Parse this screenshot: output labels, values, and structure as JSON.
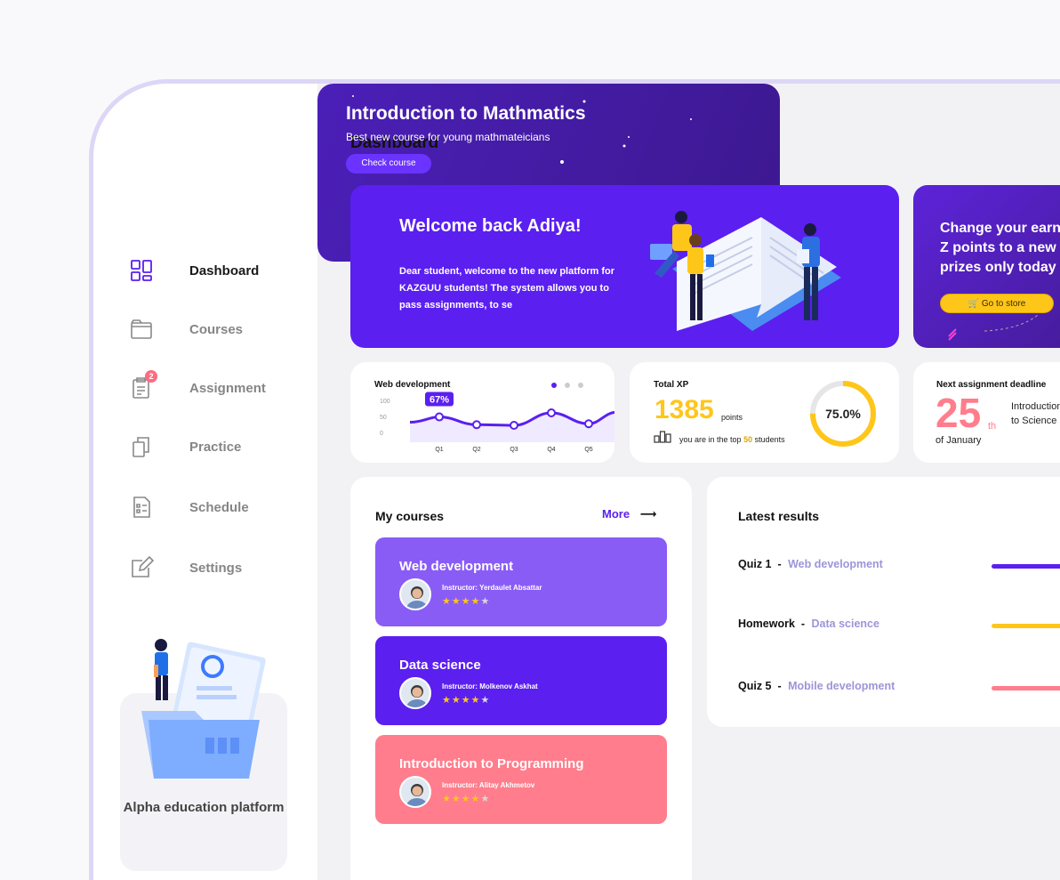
{
  "sidebar": {
    "items": [
      {
        "label": "Dashboard",
        "icon": "dashboard-icon",
        "active": true
      },
      {
        "label": "Courses",
        "icon": "folder-icon"
      },
      {
        "label": "Assignment",
        "icon": "clipboard-icon",
        "badge": "2"
      },
      {
        "label": "Practice",
        "icon": "copy-icon"
      },
      {
        "label": "Schedule",
        "icon": "schedule-icon"
      },
      {
        "label": "Settings",
        "icon": "edit-icon"
      }
    ],
    "promo_text": "Alpha education platform"
  },
  "main": {
    "title": "Dashboard",
    "welcome": {
      "heading": "Welcome back Adiya!",
      "body": "Dear student, welcome to the new platform for KAZGUU students! The system allows you to pass assignments, to se"
    },
    "store": {
      "text": "Change your earned Z points to a new prizes only today",
      "button": "Go to store"
    },
    "webdev_card": {
      "title": "Web development",
      "tooltip": "67%"
    },
    "xp_card": {
      "title": "Total XP",
      "points": "1385",
      "points_unit": "points",
      "rank_prefix": "you are in the top",
      "rank_value": "50",
      "rank_suffix": "students",
      "gauge_label": "75.0%",
      "gauge_value": 0.75
    },
    "deadline_card": {
      "title": "Next assignment deadline",
      "day": "25",
      "suffix": "th",
      "month": "of January",
      "course": "Introduction to Science"
    },
    "courses": {
      "title": "My courses",
      "more": "More",
      "list": [
        {
          "title": "Web development",
          "instructor": "Instructor: Yerdaulet Absattar",
          "color": "#8a5cf6",
          "rating": 4
        },
        {
          "title": "Data science",
          "instructor": "Instructor: Molkenov Askhat",
          "color": "#5b1ff0",
          "rating": 4
        },
        {
          "title": "Introduction to Programming",
          "instructor": "Instructor: Alitay Akhmetov",
          "color": "#ff7d8c",
          "rating": 4
        }
      ]
    },
    "results": {
      "title": "Latest results",
      "rows": [
        {
          "name": "Quiz 1",
          "course": "Web development",
          "color": "#5b1ff0"
        },
        {
          "name": "Homework",
          "course": "Data science",
          "color": "#ffc61a"
        },
        {
          "name": "Quiz 5",
          "course": "Mobile development",
          "color": "#ff7d8c"
        }
      ]
    },
    "math": {
      "title": "Introduction to Mathmatics",
      "subtitle": "Best new course for young mathmateicians",
      "button": "Check course"
    }
  },
  "chart_data": {
    "type": "line",
    "title": "Web development",
    "categories": [
      "Q1",
      "Q2",
      "Q3",
      "Q4",
      "Q5"
    ],
    "yticks": [
      "100",
      "50",
      "0"
    ],
    "ylim": [
      0,
      100
    ],
    "series": [
      {
        "values": [
          67,
          42,
          40,
          80,
          45
        ]
      }
    ],
    "highlight": {
      "category": "Q1",
      "label": "67%"
    },
    "color": "#5b1ff0"
  }
}
